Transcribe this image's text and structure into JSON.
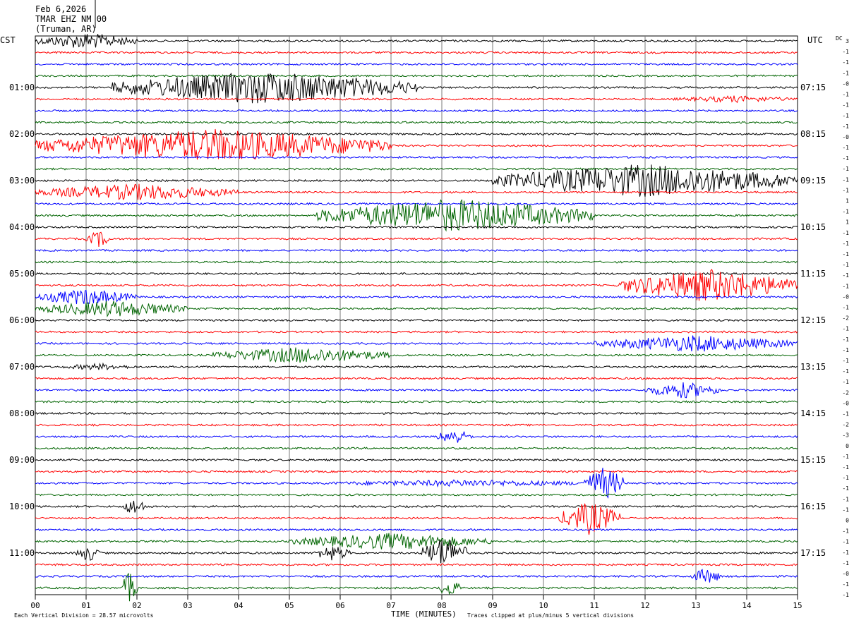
{
  "header": {
    "date": "Feb 6,2026",
    "station": "TMAR EHZ NM 00",
    "location": "(Truman, AR)"
  },
  "left_zone": "CST",
  "right_zone": "UTC",
  "dc_label": "DC",
  "footer": {
    "scale": "Each Vertical Division =   28.57 microvolts",
    "xlabel": "TIME (MINUTES)",
    "clip": "Traces clipped at plus/minus 5 vertical divisions"
  },
  "chart_data": {
    "type": "line",
    "title": "TMAR EHZ NM 00",
    "xlabel": "TIME (MINUTES)",
    "xlim": [
      0,
      15
    ],
    "x_ticks": [
      "00",
      "01",
      "02",
      "03",
      "04",
      "05",
      "06",
      "07",
      "08",
      "09",
      "10",
      "11",
      "12",
      "13",
      "14",
      "15"
    ],
    "trace_count": 48,
    "minutes_per_trace": 15,
    "trace_colors": [
      "#000000",
      "#ff0000",
      "#0000ff",
      "#006400"
    ],
    "left_hour_labels": [
      "01:00",
      "02:00",
      "03:00",
      "04:00",
      "05:00",
      "06:00",
      "07:00",
      "08:00",
      "09:00",
      "10:00",
      "11:00"
    ],
    "right_hour_labels": [
      "07:15",
      "08:15",
      "09:15",
      "10:15",
      "11:15",
      "12:15",
      "13:15",
      "14:15",
      "15:15",
      "16:15",
      "17:15"
    ],
    "dc_offsets": [
      "3",
      "-1",
      "-1",
      "-1",
      "-0",
      "-1",
      "-1",
      "-1",
      "-1",
      "-0",
      "-1",
      "-1",
      "-1",
      "-1",
      "-1",
      "1",
      "-1",
      "1",
      "-1",
      "-1",
      "-1",
      "-1",
      "-1",
      "-1",
      "-0",
      "-1",
      "-2",
      "-1",
      "-1",
      "-1",
      "-1",
      "-1",
      "-1",
      "-2",
      "-0",
      "-1",
      "-2",
      "-3",
      "0",
      "-1",
      "-1",
      "-1",
      "-1",
      "-1",
      "-1",
      "0",
      "-1",
      "-1",
      "-1",
      "-1",
      "-0",
      "-1",
      "-1"
    ],
    "events": [
      {
        "trace": 0,
        "start": 0.0,
        "end": 2.0,
        "level": "moderate",
        "color": "#000000"
      },
      {
        "trace": 4,
        "start": 1.5,
        "end": 7.5,
        "level": "strong",
        "color": "#000000"
      },
      {
        "trace": 5,
        "start": 12.5,
        "end": 15.0,
        "level": "weak",
        "color": "#ff0000"
      },
      {
        "trace": 9,
        "start": 0.0,
        "end": 7.0,
        "level": "strong",
        "color": "#ff0000"
      },
      {
        "trace": 12,
        "start": 9.0,
        "end": 15.0,
        "level": "strong",
        "color": "#000000"
      },
      {
        "trace": 13,
        "start": 0.0,
        "end": 4.0,
        "level": "moderate",
        "color": "#ff0000"
      },
      {
        "trace": 15,
        "start": 5.5,
        "end": 11.0,
        "level": "strong",
        "color": "#006400"
      },
      {
        "trace": 17,
        "start": 1.0,
        "end": 1.5,
        "level": "moderate",
        "color": "#ff0000"
      },
      {
        "trace": 21,
        "start": 11.5,
        "end": 15.0,
        "level": "strong",
        "color": "#ff0000"
      },
      {
        "trace": 22,
        "start": 0.0,
        "end": 2.0,
        "level": "moderate",
        "color": "#0000ff"
      },
      {
        "trace": 23,
        "start": 0.0,
        "end": 3.0,
        "level": "moderate",
        "color": "#006400"
      },
      {
        "trace": 26,
        "start": 11.0,
        "end": 15.0,
        "level": "moderate",
        "color": "#0000ff"
      },
      {
        "trace": 27,
        "start": 3.5,
        "end": 7.0,
        "level": "moderate",
        "color": "#006400"
      },
      {
        "trace": 28,
        "start": 0.5,
        "end": 2.0,
        "level": "weak",
        "color": "#000000"
      },
      {
        "trace": 30,
        "start": 12.0,
        "end": 13.5,
        "level": "moderate",
        "color": "#0000ff"
      },
      {
        "trace": 34,
        "start": 7.9,
        "end": 8.6,
        "level": "moderate",
        "color": "#0000ff"
      },
      {
        "trace": 38,
        "start": 5.5,
        "end": 11.5,
        "level": "weak",
        "color": "#0000ff"
      },
      {
        "trace": 38,
        "start": 10.8,
        "end": 11.6,
        "level": "strong",
        "color": "#0000ff"
      },
      {
        "trace": 40,
        "start": 1.7,
        "end": 2.2,
        "level": "moderate",
        "color": "#000000"
      },
      {
        "trace": 41,
        "start": 10.3,
        "end": 11.5,
        "level": "strong",
        "color": "#ff0000"
      },
      {
        "trace": 43,
        "start": 5.0,
        "end": 9.0,
        "level": "moderate",
        "color": "#006400"
      },
      {
        "trace": 44,
        "start": 0.8,
        "end": 1.3,
        "level": "moderate",
        "color": "#000000"
      },
      {
        "trace": 44,
        "start": 5.5,
        "end": 6.2,
        "level": "moderate",
        "color": "#000000"
      },
      {
        "trace": 44,
        "start": 7.6,
        "end": 8.5,
        "level": "strong",
        "color": "#000000"
      },
      {
        "trace": 47,
        "start": 1.7,
        "end": 2.0,
        "level": "strong",
        "color": "#006400"
      },
      {
        "trace": 47,
        "start": 7.9,
        "end": 8.4,
        "level": "moderate",
        "color": "#006400"
      },
      {
        "trace": 46,
        "start": 12.9,
        "end": 13.5,
        "level": "moderate",
        "color": "#0000ff"
      }
    ]
  }
}
